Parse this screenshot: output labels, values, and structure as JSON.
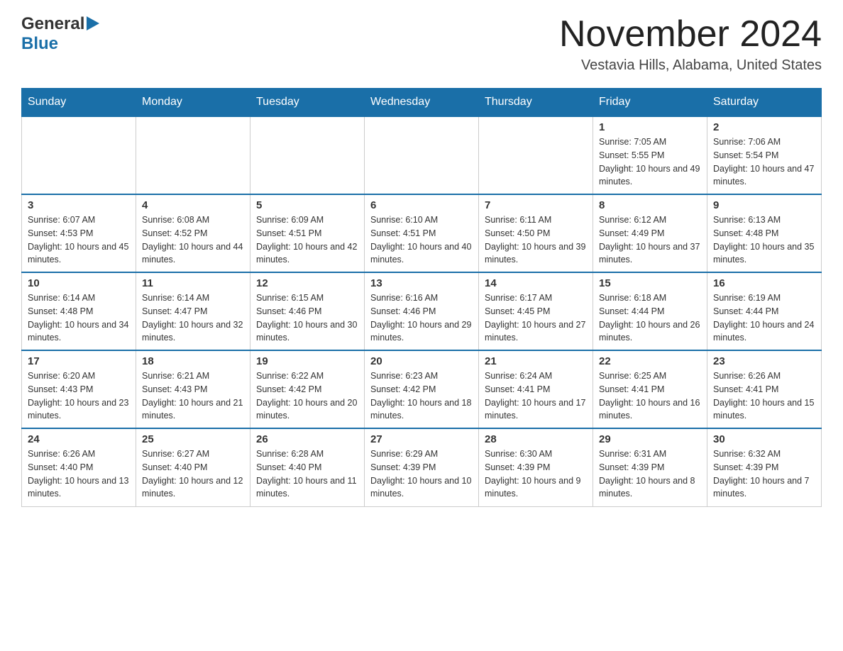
{
  "logo": {
    "general": "General",
    "triangle": "▶",
    "blue": "Blue"
  },
  "title": {
    "month": "November 2024",
    "location": "Vestavia Hills, Alabama, United States"
  },
  "weekdays": [
    "Sunday",
    "Monday",
    "Tuesday",
    "Wednesday",
    "Thursday",
    "Friday",
    "Saturday"
  ],
  "weeks": [
    [
      {
        "day": "",
        "info": ""
      },
      {
        "day": "",
        "info": ""
      },
      {
        "day": "",
        "info": ""
      },
      {
        "day": "",
        "info": ""
      },
      {
        "day": "",
        "info": ""
      },
      {
        "day": "1",
        "info": "Sunrise: 7:05 AM\nSunset: 5:55 PM\nDaylight: 10 hours and 49 minutes."
      },
      {
        "day": "2",
        "info": "Sunrise: 7:06 AM\nSunset: 5:54 PM\nDaylight: 10 hours and 47 minutes."
      }
    ],
    [
      {
        "day": "3",
        "info": "Sunrise: 6:07 AM\nSunset: 4:53 PM\nDaylight: 10 hours and 45 minutes."
      },
      {
        "day": "4",
        "info": "Sunrise: 6:08 AM\nSunset: 4:52 PM\nDaylight: 10 hours and 44 minutes."
      },
      {
        "day": "5",
        "info": "Sunrise: 6:09 AM\nSunset: 4:51 PM\nDaylight: 10 hours and 42 minutes."
      },
      {
        "day": "6",
        "info": "Sunrise: 6:10 AM\nSunset: 4:51 PM\nDaylight: 10 hours and 40 minutes."
      },
      {
        "day": "7",
        "info": "Sunrise: 6:11 AM\nSunset: 4:50 PM\nDaylight: 10 hours and 39 minutes."
      },
      {
        "day": "8",
        "info": "Sunrise: 6:12 AM\nSunset: 4:49 PM\nDaylight: 10 hours and 37 minutes."
      },
      {
        "day": "9",
        "info": "Sunrise: 6:13 AM\nSunset: 4:48 PM\nDaylight: 10 hours and 35 minutes."
      }
    ],
    [
      {
        "day": "10",
        "info": "Sunrise: 6:14 AM\nSunset: 4:48 PM\nDaylight: 10 hours and 34 minutes."
      },
      {
        "day": "11",
        "info": "Sunrise: 6:14 AM\nSunset: 4:47 PM\nDaylight: 10 hours and 32 minutes."
      },
      {
        "day": "12",
        "info": "Sunrise: 6:15 AM\nSunset: 4:46 PM\nDaylight: 10 hours and 30 minutes."
      },
      {
        "day": "13",
        "info": "Sunrise: 6:16 AM\nSunset: 4:46 PM\nDaylight: 10 hours and 29 minutes."
      },
      {
        "day": "14",
        "info": "Sunrise: 6:17 AM\nSunset: 4:45 PM\nDaylight: 10 hours and 27 minutes."
      },
      {
        "day": "15",
        "info": "Sunrise: 6:18 AM\nSunset: 4:44 PM\nDaylight: 10 hours and 26 minutes."
      },
      {
        "day": "16",
        "info": "Sunrise: 6:19 AM\nSunset: 4:44 PM\nDaylight: 10 hours and 24 minutes."
      }
    ],
    [
      {
        "day": "17",
        "info": "Sunrise: 6:20 AM\nSunset: 4:43 PM\nDaylight: 10 hours and 23 minutes."
      },
      {
        "day": "18",
        "info": "Sunrise: 6:21 AM\nSunset: 4:43 PM\nDaylight: 10 hours and 21 minutes."
      },
      {
        "day": "19",
        "info": "Sunrise: 6:22 AM\nSunset: 4:42 PM\nDaylight: 10 hours and 20 minutes."
      },
      {
        "day": "20",
        "info": "Sunrise: 6:23 AM\nSunset: 4:42 PM\nDaylight: 10 hours and 18 minutes."
      },
      {
        "day": "21",
        "info": "Sunrise: 6:24 AM\nSunset: 4:41 PM\nDaylight: 10 hours and 17 minutes."
      },
      {
        "day": "22",
        "info": "Sunrise: 6:25 AM\nSunset: 4:41 PM\nDaylight: 10 hours and 16 minutes."
      },
      {
        "day": "23",
        "info": "Sunrise: 6:26 AM\nSunset: 4:41 PM\nDaylight: 10 hours and 15 minutes."
      }
    ],
    [
      {
        "day": "24",
        "info": "Sunrise: 6:26 AM\nSunset: 4:40 PM\nDaylight: 10 hours and 13 minutes."
      },
      {
        "day": "25",
        "info": "Sunrise: 6:27 AM\nSunset: 4:40 PM\nDaylight: 10 hours and 12 minutes."
      },
      {
        "day": "26",
        "info": "Sunrise: 6:28 AM\nSunset: 4:40 PM\nDaylight: 10 hours and 11 minutes."
      },
      {
        "day": "27",
        "info": "Sunrise: 6:29 AM\nSunset: 4:39 PM\nDaylight: 10 hours and 10 minutes."
      },
      {
        "day": "28",
        "info": "Sunrise: 6:30 AM\nSunset: 4:39 PM\nDaylight: 10 hours and 9 minutes."
      },
      {
        "day": "29",
        "info": "Sunrise: 6:31 AM\nSunset: 4:39 PM\nDaylight: 10 hours and 8 minutes."
      },
      {
        "day": "30",
        "info": "Sunrise: 6:32 AM\nSunset: 4:39 PM\nDaylight: 10 hours and 7 minutes."
      }
    ]
  ]
}
